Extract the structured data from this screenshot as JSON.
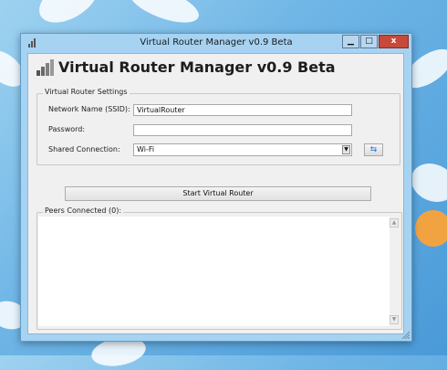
{
  "window": {
    "title": "Virtual Router Manager v0.9 Beta",
    "controls": {
      "minimize": "▁",
      "maximize": "□",
      "close": "x"
    }
  },
  "header": {
    "title": "Virtual Router Manager v0.9 Beta"
  },
  "settings": {
    "legend": "Virtual Router Settings",
    "ssid_label": "Network Name (SSID):",
    "ssid_value": "VirtualRouter",
    "password_label": "Password:",
    "password_value": "",
    "shared_label": "Shared Connection:",
    "shared_value": "Wi-Fi",
    "combo_arrow": "▼",
    "refresh_glyph": "⇆"
  },
  "actions": {
    "start_label": "Start Virtual Router"
  },
  "peers": {
    "legend": "Peers Connected (0):",
    "scroll_up": "▲",
    "scroll_down": "▼"
  },
  "colors": {
    "desktop": "#6fb6e6",
    "window_frame": "#a6d3f2",
    "close_button": "#c74939",
    "client_bg": "#f0f0f0"
  },
  "icons": {
    "app": "signal-bars-icon",
    "refresh": "refresh-icon",
    "resize": "resize-grip-icon"
  }
}
